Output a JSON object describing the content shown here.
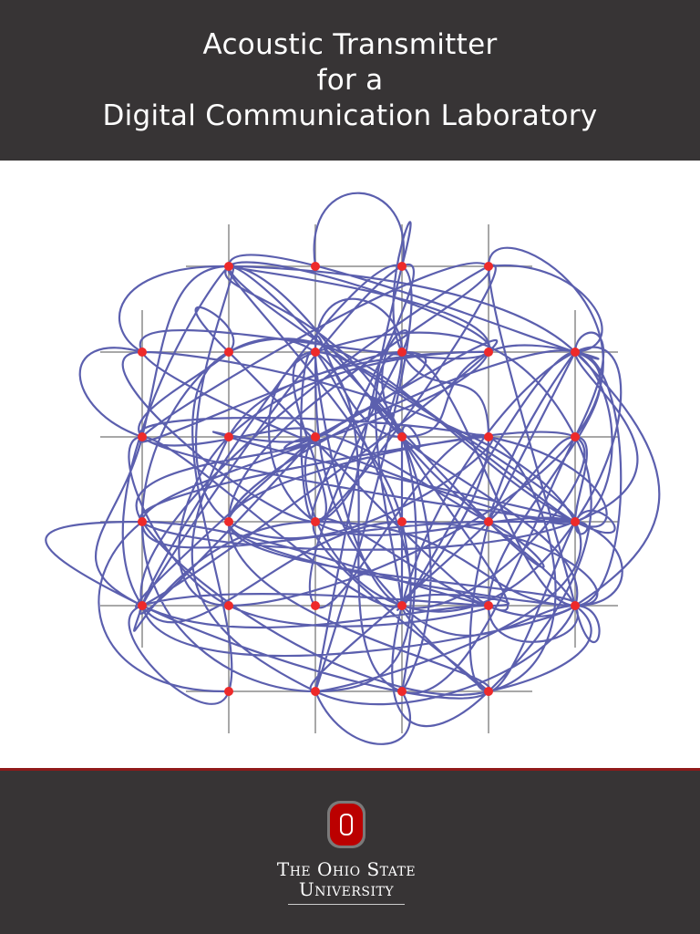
{
  "cover": {
    "title_lines": [
      "Acoustic Transmitter",
      "for a",
      "Digital Communication Laboratory"
    ]
  },
  "figure": {
    "curve_color": "#5b5fae",
    "point_color": "#ee2a2a",
    "grid_color": "#a8a8a8"
  },
  "footer": {
    "logo_icon": "block-o-icon",
    "university_line1": "The Ohio State",
    "university_line2": "University",
    "brand_colors": {
      "scarlet": "#bb0000",
      "gray": "#373435"
    }
  }
}
